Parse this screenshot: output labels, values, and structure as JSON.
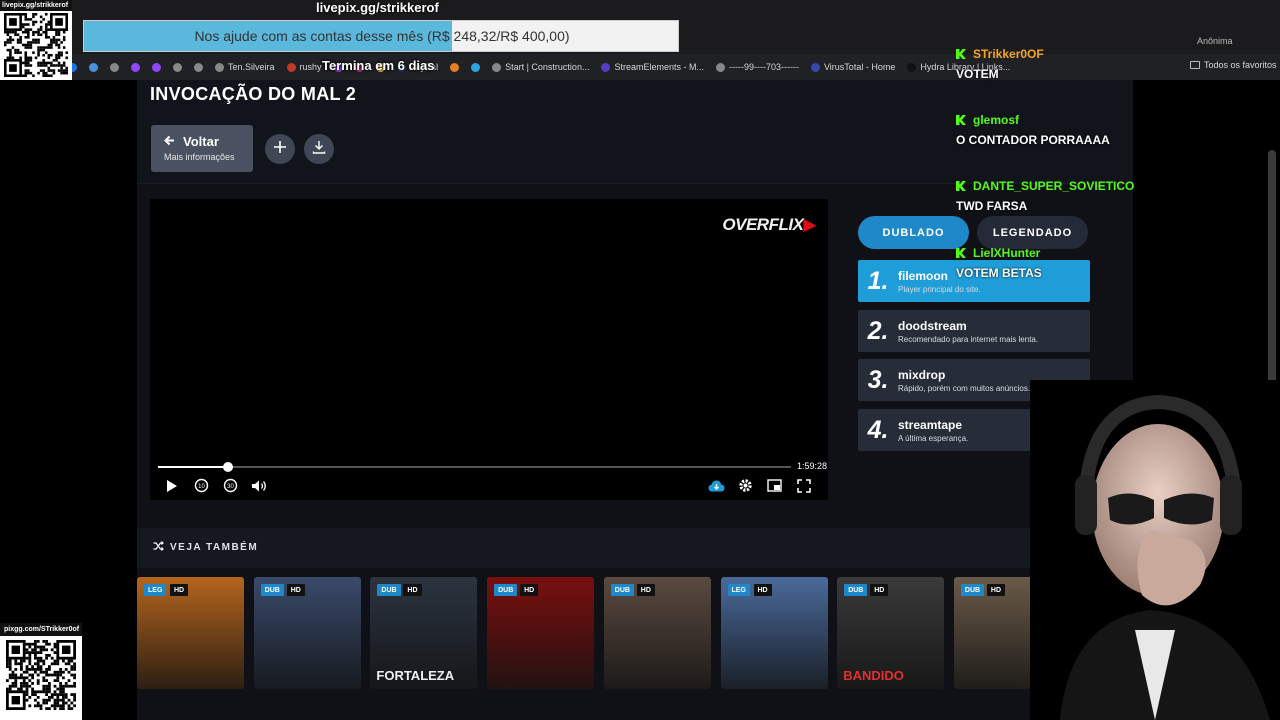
{
  "browser": {
    "bookmarks": [
      {
        "label": "",
        "color": "#1877f2"
      },
      {
        "label": "",
        "color": "#4a90d9"
      },
      {
        "label": "",
        "color": "#888888"
      },
      {
        "label": "",
        "color": "#9146ff"
      },
      {
        "label": "",
        "color": "#9146ff"
      },
      {
        "label": "",
        "color": "#888888"
      },
      {
        "label": "",
        "color": "#888888"
      },
      {
        "label": "Ten.Silveira",
        "color": "#888888"
      },
      {
        "label": "rushy",
        "color": "#c0392b"
      },
      {
        "label": "",
        "color": "#9146ff"
      },
      {
        "label": "",
        "color": "#c13584"
      },
      {
        "label": "",
        "color": "#f0c040"
      },
      {
        "label": "PayPal",
        "color": "#253b80"
      },
      {
        "label": "",
        "color": "#e67e22"
      },
      {
        "label": "",
        "color": "#2ca5e0"
      },
      {
        "label": "Start | Construction...",
        "color": "#888888"
      },
      {
        "label": "StreamElements - M...",
        "color": "#5b3cc4"
      },
      {
        "label": "-----99----703------",
        "color": "#888888"
      },
      {
        "label": "VirusTotal - Home",
        "color": "#3949ab"
      },
      {
        "label": "Hydra Library | Links...",
        "color": "#111111"
      }
    ],
    "all_favorites": "Todos os favoritos",
    "profile": "Anônima"
  },
  "site": {
    "title": "INVOCAÇÃO DO MAL 2",
    "back": {
      "label": "Voltar",
      "sub": "Mais informações"
    },
    "logo": "OVERFLIX",
    "player": {
      "duration": "1:59:28",
      "progress": 0.11
    },
    "lang": {
      "dubbed": "DUBLADO",
      "subbed": "LEGENDADO"
    },
    "servers": [
      {
        "num": "1.",
        "name": "filemoon",
        "desc": "Player principal do site."
      },
      {
        "num": "2.",
        "name": "doodstream",
        "desc": "Recomendado para internet mais lenta."
      },
      {
        "num": "3.",
        "name": "mixdrop",
        "desc": "Rápido, porém com muitos anúncios."
      },
      {
        "num": "4.",
        "name": "streamtape",
        "desc": "A última esperança."
      }
    ],
    "see_also": "VEJA TAMBÉM",
    "posters": [
      {
        "lang": "LEG",
        "hd": "HD",
        "title": "",
        "color": "#b5651d"
      },
      {
        "lang": "DUB",
        "hd": "HD",
        "title": "",
        "color": "#3a4a6b"
      },
      {
        "lang": "DUB",
        "hd": "HD",
        "title": "FORTALEZA",
        "color": "#2c3440"
      },
      {
        "lang": "DUB",
        "hd": "HD",
        "title": "",
        "color": "#7a1010"
      },
      {
        "lang": "DUB",
        "hd": "HD",
        "title": "",
        "color": "#5a4a40"
      },
      {
        "lang": "LEG",
        "hd": "HD",
        "title": "",
        "color": "#4a6a9a"
      },
      {
        "lang": "DUB",
        "hd": "HD",
        "title": "BANDIDO",
        "color": "#3a3a3a"
      },
      {
        "lang": "DUB",
        "hd": "HD",
        "title": "",
        "color": "#6a5a48"
      }
    ]
  },
  "overlay": {
    "qr_top_caption": "livepix.gg/strikkerof",
    "qr_bottom_caption": "pixgg.com/STrikker0of",
    "donation_url": "livepix.gg/strikkerof",
    "goal_text": "Nos ajude com as contas desse mês (R$ 248,32/R$ 400,00)",
    "goal_fraction": 0.62,
    "goal_ends": "Termina em 6 dias"
  },
  "chat": [
    {
      "user": "STrikker0OF",
      "color": "#f5a623",
      "text": "VOTEM"
    },
    {
      "user": "glemosf",
      "color": "#53fc18",
      "text": "O CONTADOR PORRAAAA"
    },
    {
      "user": "DANTE_SUPER_SOVIETICO",
      "color": "#53fc18",
      "text": "TWD FARSA"
    },
    {
      "user": "LielXHunter",
      "color": "#53fc18",
      "text": "VOTEM BETAS"
    }
  ]
}
